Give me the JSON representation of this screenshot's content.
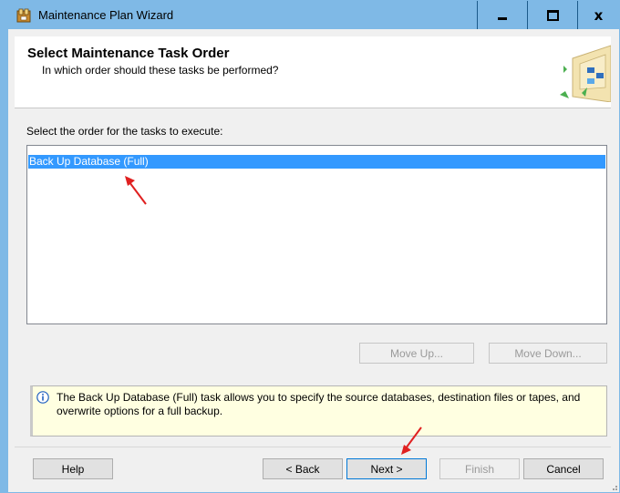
{
  "window": {
    "title": "Maintenance Plan Wizard",
    "controls": {
      "minimize": "minimize-icon",
      "maximize": "maximize-icon",
      "close": "close-icon"
    },
    "accent": "#7fb9e6"
  },
  "header": {
    "title": "Select Maintenance Task Order",
    "subtitle": "In which order should these tasks be performed?"
  },
  "main": {
    "order_label": "Select the order for the tasks to execute:",
    "tasks": [
      "Back Up Database (Full)"
    ],
    "selected_task_index": 0,
    "move_up_label": "Move Up...",
    "move_down_label": "Move Down..."
  },
  "info": {
    "text": "The Back Up Database (Full) task allows you to specify the source databases, destination files or tapes, and overwrite options for a full backup."
  },
  "footer": {
    "help_label": "Help",
    "back_label": "< Back",
    "next_label": "Next >",
    "finish_label": "Finish",
    "cancel_label": "Cancel"
  },
  "colors": {
    "selection": "#3399ff",
    "info_background": "#ffffe1",
    "annotation_arrow": "#e02020"
  }
}
